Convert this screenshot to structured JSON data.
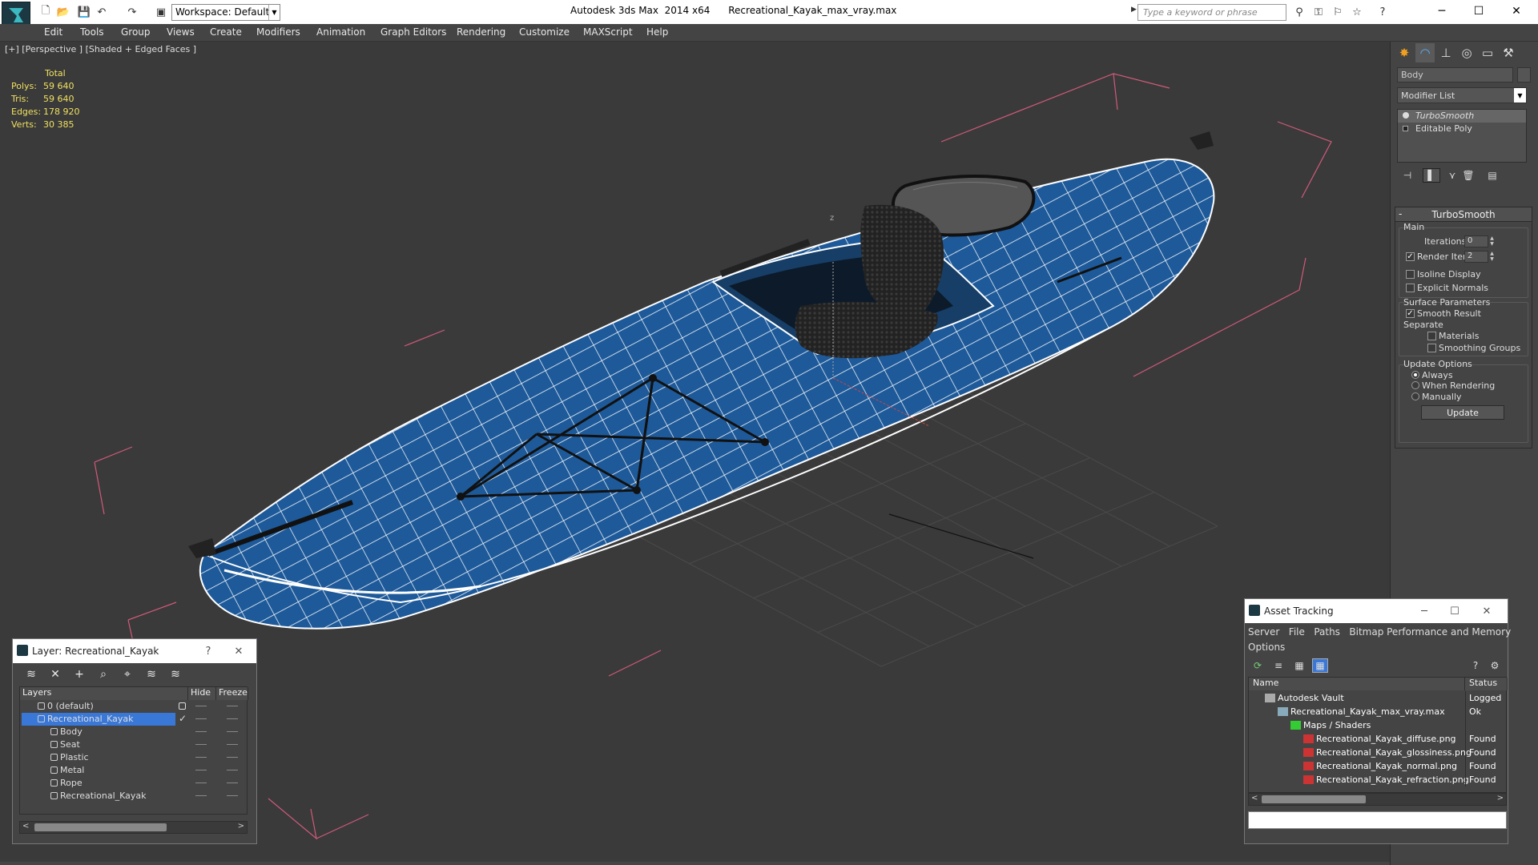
{
  "app": {
    "title_app": "Autodesk 3ds Max  2014 x64",
    "title_file": "Recreational_Kayak_max_vray.max",
    "workspace": "Workspace: Default",
    "search_placeholder": "Type a keyword or phrase"
  },
  "menu": [
    "Edit",
    "Tools",
    "Group",
    "Views",
    "Create",
    "Modifiers",
    "Animation",
    "Graph Editors",
    "Rendering",
    "Customize",
    "MAXScript",
    "Help"
  ],
  "viewport": {
    "label": "[+] [Perspective ] [Shaded + Edged Faces ]",
    "stats_header": "Total",
    "stats": [
      {
        "label": "Polys:",
        "value": "59 640"
      },
      {
        "label": "Tris:",
        "value": "59 640"
      },
      {
        "label": "Edges:",
        "value": "178 920"
      },
      {
        "label": "Verts:",
        "value": "30 385"
      }
    ],
    "axis_label": "z"
  },
  "modify_panel": {
    "object_name": "Body",
    "modifier_list": "Modifier List",
    "stack": [
      "TurboSmooth",
      "Editable Poly"
    ],
    "rollout_title": "TurboSmooth",
    "main_group": "Main",
    "iterations_label": "Iterations:",
    "iterations_value": "0",
    "render_iters_label": "Render Iters:",
    "render_iters_value": "2",
    "isoline_label": "Isoline Display",
    "explicit_normals_label": "Explicit Normals",
    "surface_group": "Surface Parameters",
    "smooth_result_label": "Smooth Result",
    "separate_label": "Separate",
    "materials_label": "Materials",
    "smoothing_groups_label": "Smoothing Groups",
    "update_group": "Update Options",
    "always_label": "Always",
    "when_rendering_label": "When Rendering",
    "manually_label": "Manually",
    "update_button": "Update"
  },
  "layer_window": {
    "title": "Layer: Recreational_Kayak",
    "help": "?",
    "col_layers": "Layers",
    "col_hide": "Hide",
    "col_freeze": "Freeze",
    "rows": [
      {
        "name": "0 (default)",
        "level": 0
      },
      {
        "name": "Recreational_Kayak",
        "level": 0,
        "selected": true
      },
      {
        "name": "Body",
        "level": 1
      },
      {
        "name": "Seat",
        "level": 1
      },
      {
        "name": "Plastic",
        "level": 1
      },
      {
        "name": "Metal",
        "level": 1
      },
      {
        "name": "Rope",
        "level": 1
      },
      {
        "name": "Recreational_Kayak",
        "level": 1
      }
    ]
  },
  "asset_window": {
    "title": "Asset Tracking",
    "menu_row1": "Server   File   Paths   Bitmap Performance and Memory",
    "menu_row2": "Options",
    "col_name": "Name",
    "col_status": "Status",
    "rows": [
      {
        "name": "Autodesk Vault",
        "status": "Logged",
        "level": 0,
        "icon": "vault"
      },
      {
        "name": "Recreational_Kayak_max_vray.max",
        "status": "Ok",
        "level": 1,
        "icon": "max"
      },
      {
        "name": "Maps / Shaders",
        "status": "",
        "level": 2,
        "icon": "maps"
      },
      {
        "name": "Recreational_Kayak_diffuse.png",
        "status": "Found",
        "level": 3,
        "icon": "png"
      },
      {
        "name": "Recreational_Kayak_glossiness.png",
        "status": "Found",
        "level": 3,
        "icon": "png"
      },
      {
        "name": "Recreational_Kayak_normal.png",
        "status": "Found",
        "level": 3,
        "icon": "png"
      },
      {
        "name": "Recreational_Kayak_refraction.png",
        "status": "Found",
        "level": 3,
        "icon": "png"
      }
    ]
  },
  "colors": {
    "kayak": "#1e5a9a",
    "wire": "#ffffff",
    "bbox": "#d05a7a",
    "selection": "#3a78d8",
    "stats": "#f0e060"
  }
}
